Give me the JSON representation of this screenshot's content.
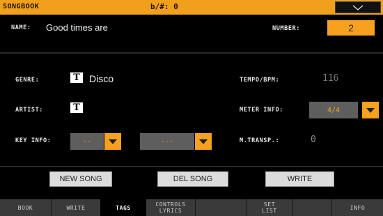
{
  "topbar": {
    "title": "SONGBOOK",
    "transpose": "b/#: 0"
  },
  "name": {
    "label": "NAME:",
    "value": "Good times are"
  },
  "number": {
    "label": "NUMBER:",
    "value": "2"
  },
  "genre": {
    "label": "GENRE:",
    "value": "Disco"
  },
  "artist": {
    "label": "ARTIST:",
    "value": ""
  },
  "key_info": {
    "label": "KEY INFO:",
    "value1": "--",
    "value2": "---"
  },
  "tempo": {
    "label": "TEMPO/BPM:",
    "value": "116"
  },
  "meter": {
    "label": "METER INFO:",
    "value": "4/4"
  },
  "mtransp": {
    "label": "M.TRANSP.:",
    "value": "0"
  },
  "buttons": {
    "new_song": "NEW SONG",
    "del_song": "DEL SONG",
    "write": "WRITE"
  },
  "tabs": [
    {
      "label": "BOOK"
    },
    {
      "label": "WRITE"
    },
    {
      "label": "TAGS"
    },
    {
      "label": "CONTROLS",
      "label2": "LYRICS"
    },
    {
      "label": "SET",
      "label2": "LIST"
    },
    {
      "label": "INFO"
    }
  ],
  "colors": {
    "accent": "#f7a11f",
    "background": "#000000"
  }
}
